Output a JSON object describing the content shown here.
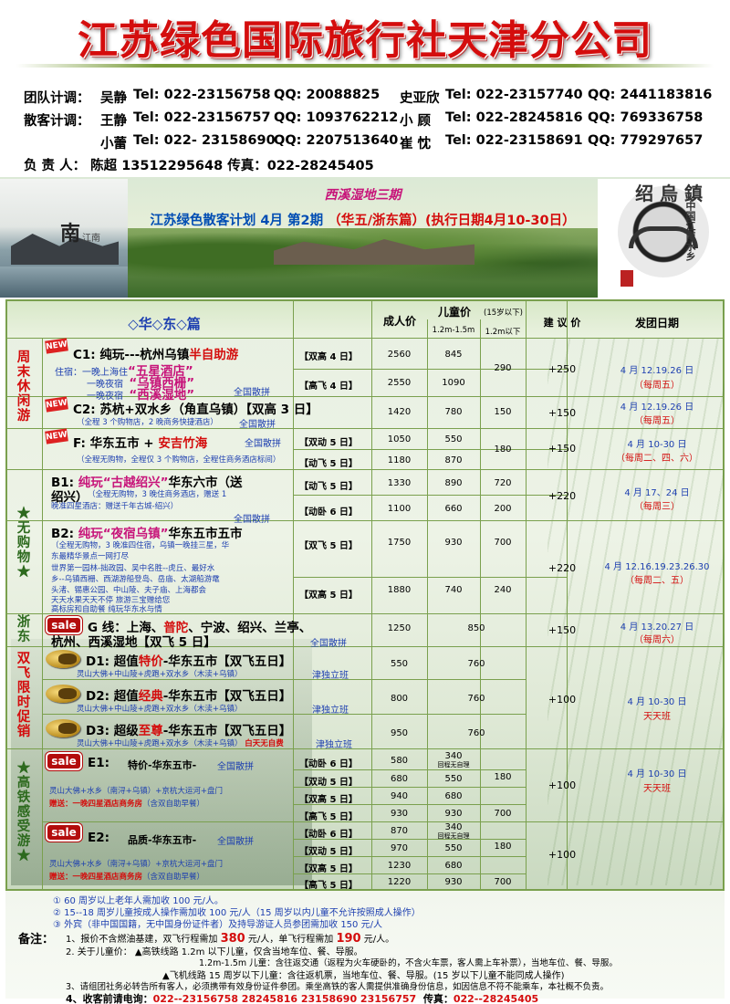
{
  "company_title": "江苏绿色国际旅行社天津分公司",
  "contacts": {
    "row1": [
      {
        "label": "团队计调：",
        "name": "吴静",
        "tel": "Tel: 022-23156758",
        "qq": "QQ: 20088825"
      },
      {
        "name": "史亚欣",
        "tel": "Tel: 022-23157740",
        "qq": "QQ: 2441183816"
      }
    ],
    "row2": [
      {
        "label": "散客计调：",
        "name": "王静",
        "tel": "Tel: 022-23156757",
        "qq": "QQ: 1093762212"
      },
      {
        "name": "小 顾",
        "tel": "Tel: 022-28245816",
        "qq": "QQ: 769336758"
      }
    ],
    "row3": [
      {
        "name": "小蕾",
        "tel": "Tel: 022- 23158690",
        "qq": "QQ: 2207513640"
      },
      {
        "name": "崔 忱",
        "tel": "Tel: 022-23158691",
        "qq": "QQ: 779297657"
      }
    ],
    "manager": "负 责 人： 陈超 13512295648  传真：022-28245405"
  },
  "banner": {
    "tag": "西溪湿地三期",
    "plan_prefix": "江苏绿色散客计划 4月 第2期",
    "plan_suffix": "（华五/浙东篇）(执行日期4月10-30日）",
    "left_char": "南",
    "left_sub": "江南",
    "right_chars": "绍 烏 鎮",
    "right_side": "中国江南水乡"
  },
  "table": {
    "section": "◇华◇东◇篇",
    "headers": {
      "adult": "成人价",
      "child": "儿童价",
      "child_note": "(15岁以下)",
      "child_h": "1.2m-1.5m",
      "child_l": "1.2m以下",
      "suggest": "建 议 价",
      "date": "发团日期"
    },
    "cat_weekend": "周末休闲游",
    "cat_nobuy": "★无购物★",
    "cat_zhedong": "浙东",
    "cat_shuangfei": "双飞限时促销",
    "cat_gaotie": "★高铁感受游★",
    "c1": {
      "code": "C1:",
      "title": "纯玩---杭州乌镇",
      "title_red": "半自助游",
      "l1": "住宿：一晚上海住",
      "l1r": "“五星酒店”",
      "l2": "一晚夜宿",
      "l2r": "“乌镇西栅”",
      "l3": "一晚夜宿",
      "l3r": "“西溪湿地”",
      "tag": "全国散拼",
      "opt1": "【双高 4 日】",
      "opt2": "【高飞 4 日】",
      "adult1": "2560",
      "adult2": "2550",
      "ch1": "845",
      "ch2": "1090",
      "cl": "290",
      "suggest": "+250",
      "date": "4 月 12.19.26 日",
      "freq": "（每周五）"
    },
    "c2": {
      "code": "C2:",
      "title": "苏杭+双水乡（角直乌镇）【双高 3 日】",
      "sub": "（全程 3 个购物店，2 晚商务快捷酒店）",
      "tag": "全国散拼",
      "adult": "1420",
      "ch": "780",
      "cl": "150",
      "suggest": "+150",
      "date": "4 月 12.19.26 日",
      "freq": "（每周五）"
    },
    "f": {
      "code": "F:",
      "title": "华东五市 + ",
      "title_red": "安吉竹海",
      "sub": "（全程无购物，全程仅 3 个购物店，全程住商务酒店标间）",
      "tag": "全国散拼",
      "opt1": "【双动 5 日】",
      "opt2": "【动飞 5 日】",
      "adult1": "1050",
      "adult2": "1180",
      "ch1": "550",
      "ch2": "870",
      "cl": "180",
      "suggest": "+150",
      "date": "4 月 10-30 日",
      "freq": "（每周二、四、六）"
    },
    "b1": {
      "code": "B1:",
      "title": "纯玩",
      "title_mag": "“古越绍兴”",
      "title2": "华东六市（送",
      "title3": "绍兴）",
      "sub1": "（全程无购物，3 晚住商务酒店，赠送 1",
      "sub2": "晚准四星酒店：赠送千年古城-绍兴）",
      "tag": "全国散拼",
      "opt1": "【动飞 5 日】",
      "opt2": "【动卧 6 日】",
      "adult1": "1330",
      "adult2": "1100",
      "ch1": "890",
      "ch2": "660",
      "cl1": "720",
      "cl2": "200",
      "suggest": "+220",
      "date": "4 月 17、24 日",
      "freq": "（每周三）"
    },
    "b2": {
      "code": "B2:",
      "title": "纯玩",
      "title_mag": "“夜宿乌镇”",
      "title2": "华东五市五市",
      "sub1": "（全程无购物，3 晚准四住宿，乌镇一晚挂三星，华",
      "sub2": "东最精华景点一网打尽",
      "d1": "世界第一园林-拙政园、吴中名胜--虎丘、最好水",
      "d2": "乡--乌镇西栅、西湖游船登岛、岳庙、太湖船游鼋",
      "d3": "头渚、锡惠公园、中山陵、夫子庙、上海都会",
      "d4": "天天水果天天不停  旅游三宝赠给您",
      "d5": "高标房和自助餐  纯玩华东水与情",
      "opt1": "【双飞 5 日】",
      "opt2": "【双高 5 日】",
      "adult1": "1750",
      "adult2": "1880",
      "ch1": "930",
      "ch2": "740",
      "cl1": "700",
      "cl2": "240",
      "suggest": "+220",
      "date": "4 月 12.16.19.23.26.30",
      "freq": "（每周二、五）"
    },
    "g": {
      "code": "G 线：",
      "title": "上海、",
      "title_mag": "普陀",
      "title2": "、宁波、绍兴、兰亭、",
      "title3": "杭州、西溪湿地【双飞 5 日】",
      "tag": "全国散拼",
      "adult": "1250",
      "ch": "850",
      "suggest": "+150",
      "date": "4 月 13.20.27 日",
      "freq": "（每周六）"
    },
    "d1": {
      "code": "D1:",
      "title": "超值",
      "title_red": "特价",
      "title2": "-华东五市【双飞五日】",
      "sub": "灵山大佛+中山陵+虎跑+双水乡（木渎+乌镇）",
      "tag": "津独立班",
      "adult": "550",
      "ch": "760"
    },
    "d2": {
      "code": "D2:",
      "title": "超值",
      "title_red": "经典",
      "title2": "-华东五市【双飞五日】",
      "sub": "灵山大佛+中山陵+虎跑+双水乡（木渎+乌镇）",
      "tag": "津独立班",
      "adult": "800",
      "ch": "760"
    },
    "d3": {
      "code": "D3:",
      "title": "超级",
      "title_red": "至尊",
      "title2": "-华东五市【双飞五日】",
      "sub": "灵山大佛+中山陵+虎跑+双水乡（木渎+乌镇）",
      "sub_red": "白天无自费",
      "tag": "津独立班",
      "adult": "950",
      "ch": "760"
    },
    "d_suggest": "+100",
    "d_date": "4 月 10-30 日",
    "d_freq": "天天班",
    "e1": {
      "code": "E1:",
      "title": "特价-华东五市-",
      "tag": "全国散拼",
      "sub1": "灵山大佛+水乡（南浔+乌镇）+京杭大运河+盘门",
      "sub2": "赠送：一晚四星酒店商务房",
      "sub2b": "（含双自助早餐）",
      "opts": [
        "【动卧 6 日】",
        "【双动 5 日】",
        "【双高 5 日】",
        "【高飞 5 日】"
      ],
      "adult": [
        "580",
        "680",
        "940",
        "930"
      ],
      "ch": [
        "340",
        "550",
        "680",
        "930"
      ],
      "ch_note": "回程无自理",
      "cl1": "180",
      "cl2": "700",
      "suggest": "+100",
      "date": "4 月 10-30 日",
      "freq": "天天班"
    },
    "e2": {
      "code": "E2:",
      "title": "品质-华东五市-",
      "tag": "全国散拼",
      "sub1": "灵山大佛+水乡（南浔+乌镇）+京杭大运河+盘门",
      "sub2": "赠送：一晚四星酒店商务房",
      "sub2b": "（含双自助早餐）",
      "opts": [
        "【动卧 6 日】",
        "【双动 5 日】",
        "【双高 5 日】",
        "【高飞 5 日】"
      ],
      "adult": [
        "870",
        "970",
        "1230",
        "1220"
      ],
      "ch": [
        "340",
        "550",
        "680",
        "930"
      ],
      "ch_note": "回程无自理",
      "cl1": "180",
      "cl2": "700",
      "suggest": "+100"
    },
    "sale_label": "sale",
    "new_label": "NEW"
  },
  "footnotes": {
    "n1": "①   60 周岁以上老年人需加收 100 元/人。",
    "n2": "②   15--18 周岁儿童按成人操作需加收 100 元/人（15 周岁以内儿童不允许按照成人操作）",
    "n3": "③   外宾（非中国国籍，无中国身份证件者）及持导游证人员参团需加收 150 元/人"
  },
  "notes": {
    "label": "备注：",
    "l1a": "1、报价不含燃油基建，双飞行程需加",
    "l1b": "380",
    "l1c": "元/人，单飞行程需加",
    "l1d": "190",
    "l1e": "元/人。",
    "l2": "2. 关于儿童价：  ▲高铁线路 1.2m 以下儿童，仅含当地车位、餐、导服。",
    "l3": "1.2m-1.5m 儿童：含往返交通（返程为火车硬卧的，不含火车票，客人需上车补票），当地车位、餐、导服。",
    "l4": "▲飞机线路  15 周岁以下儿童：含往返机票，当地车位、餐、导服。(15 岁以下儿童不能同成人操作)",
    "l5": "3、请组团社务必转告所有客人，必须携带有效身份证件参团。乘坐高铁的客人需提供准确身份信息，如因信息不符不能乘车，本社概不负责。",
    "l6a": "4、收客前请电询：",
    "l6b": "022--23156758   28245816   23158690   23156757",
    "l6c": "传真：",
    "l6d": "022--28245405"
  }
}
